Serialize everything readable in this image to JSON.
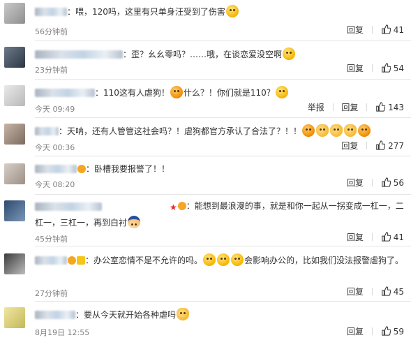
{
  "ui": {
    "reply_label": "回复",
    "report_label": "举报"
  },
  "comments": [
    {
      "text": "：喂，120吗，这里有只单身汪受到了伤害",
      "time": "56分钟前",
      "likes": "41"
    },
    {
      "text": "：歪？幺幺零吗？……哦，在谈恋爱没空啊",
      "time": "23分钟前",
      "likes": "54"
    },
    {
      "text": "：110这有人虐狗！",
      "text2": "什么？！你们就是110？",
      "time": "今天 09:49",
      "likes": "143"
    },
    {
      "text": "：天呐，还有人管管这社会吗？！虐狗都官方承认了合法了？！！",
      "time": "今天 00:36",
      "likes": "277"
    },
    {
      "text": "：卧槽我要报警了！！",
      "time": "今天 08:20",
      "likes": "56"
    },
    {
      "text": "：能想到最浪漫的事，就是和你一起从一拐变成一杠一，二杠一，三杠一，再到白衬",
      "time": "45分钟前",
      "likes": "41"
    },
    {
      "text": "：办公室恋情不是不允许的吗。",
      "text2": "会影响办公的，比如我们没法报警虐狗了。",
      "time": "27分钟前",
      "likes": "45"
    },
    {
      "text": "：要从今天就开始各种虐吗",
      "time": "8月19日 12:55",
      "likes": "59"
    }
  ]
}
